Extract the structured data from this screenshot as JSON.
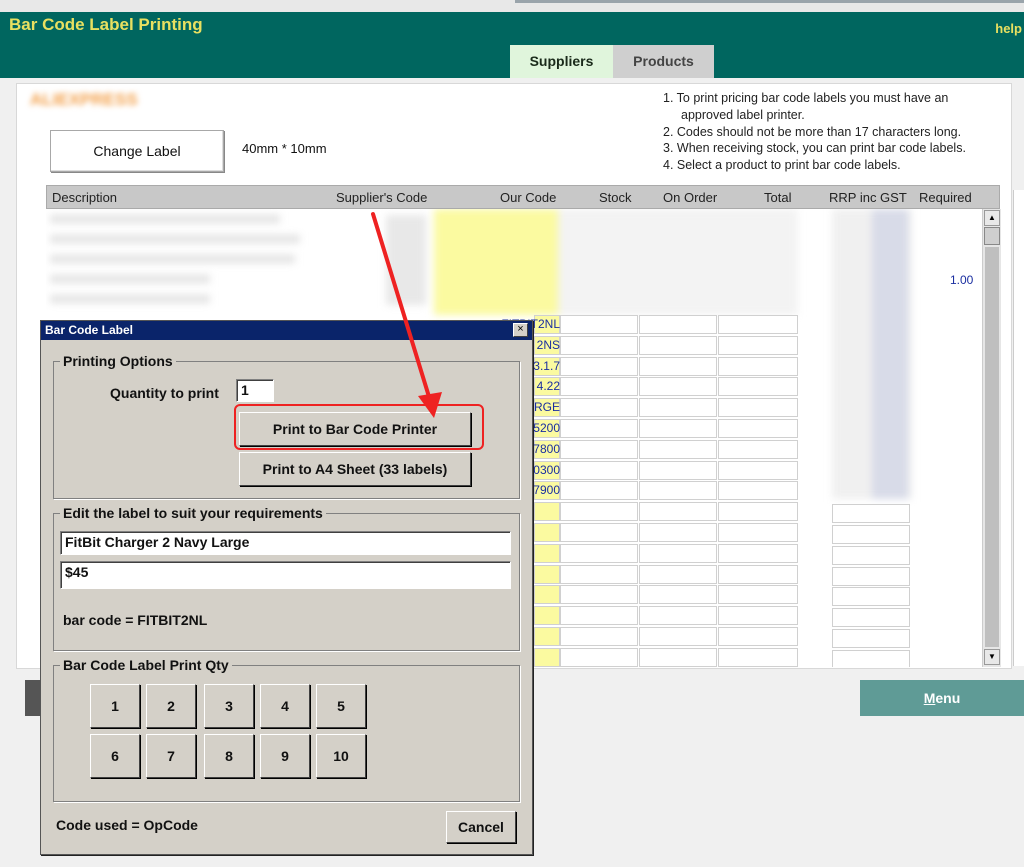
{
  "app": {
    "title": "Bar Code Label Printing",
    "help": "help"
  },
  "tabs": [
    {
      "label": "Suppliers",
      "active": true
    },
    {
      "label": "Products",
      "active": false
    }
  ],
  "supplier": {
    "name": "ALIEXPRESS"
  },
  "label": {
    "change_button": "Change Label",
    "size": "40mm * 10mm"
  },
  "instructions": [
    "1. To print pricing bar code labels you must have an",
    "approved label printer.",
    "2. Codes should not be more than 17 characters long.",
    "3. When receiving stock, you can print bar code labels.",
    "4. Select a product to print bar code labels."
  ],
  "table": {
    "headers": [
      "Description",
      "Supplier's Code",
      "Our Code",
      "Stock",
      "On Order",
      "Total",
      "RRP inc GST",
      "Required"
    ],
    "required_value": "1.00",
    "code_fragments": [
      "FITBIT2NL",
      "2NS",
      "3.1.7",
      "4.22",
      "RGE",
      "5200",
      "7800",
      "0300",
      "7900"
    ]
  },
  "menu": {
    "label": "Menu"
  },
  "dialog": {
    "title": "Bar Code Label",
    "close": "×",
    "printing_options": {
      "legend": "Printing Options",
      "qty_label": "Quantity to print",
      "qty_value": "1",
      "print_barcode": "Print to Bar Code Printer",
      "print_a4": "Print to A4 Sheet (33 labels)"
    },
    "edit_label": {
      "legend": "Edit the label to suit your requirements",
      "line1": "FitBit Charger 2 Navy Large",
      "line2": "$45",
      "barcode_text": "bar code = FITBIT2NL"
    },
    "print_qty": {
      "legend": "Bar Code Label Print Qty",
      "buttons": [
        "1",
        "2",
        "3",
        "4",
        "5",
        "6",
        "7",
        "8",
        "9",
        "10"
      ]
    },
    "code_used": "Code used =  OpCode",
    "cancel": "Cancel"
  },
  "colors": {
    "header_bg": "#00665f",
    "title_fg": "#e8e060",
    "tab_active": "#e0f5dc",
    "menu_bg": "#5f9b96",
    "dialog_title": "#0a246a",
    "highlight": "#ee2222"
  }
}
